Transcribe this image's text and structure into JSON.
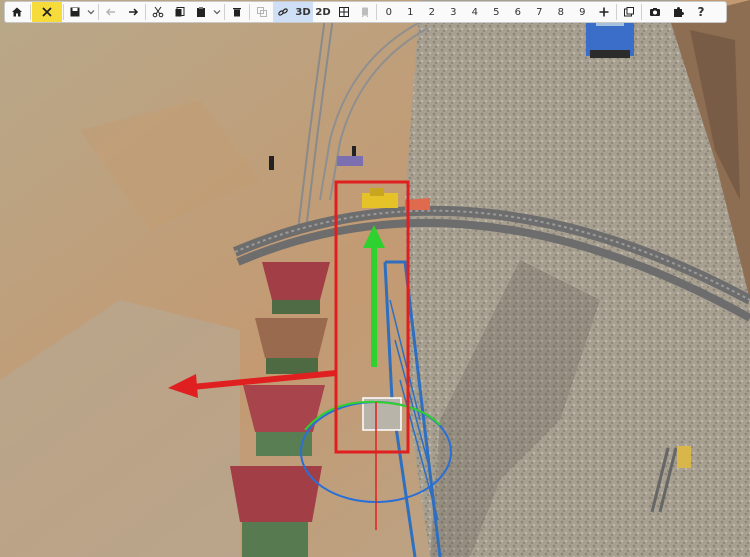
{
  "toolbar": {
    "home": {
      "icon": "home-icon"
    },
    "tools": {
      "icon": "wrench-screwdriver-icon",
      "active": true,
      "color": "#f6dc3a"
    },
    "save": {
      "icon": "save-icon"
    },
    "undo": {
      "icon": "undo-arrow-icon",
      "disabled": true
    },
    "redo": {
      "icon": "redo-arrow-icon"
    },
    "cut": {
      "icon": "scissors-icon"
    },
    "copy": {
      "icon": "copy-icon"
    },
    "paste": {
      "icon": "paste-icon"
    },
    "delete": {
      "icon": "trash-icon"
    },
    "duplicate": {
      "icon": "duplicate-icon",
      "disabled": true
    },
    "link": {
      "icon": "link-icon",
      "active": true,
      "color": "#cfe0f6"
    },
    "view3d_label": "3D",
    "view2d_label": "2D",
    "grid": {
      "icon": "grid-icon"
    },
    "train": {
      "icon": "train-icon",
      "disabled": true
    },
    "layers": [
      "0",
      "1",
      "2",
      "3",
      "4",
      "5",
      "6",
      "7",
      "8",
      "9"
    ],
    "add": {
      "icon": "plus-icon"
    },
    "window": {
      "icon": "window-icon"
    },
    "camera": {
      "icon": "camera-icon"
    },
    "extensions": {
      "icon": "puzzle-icon"
    },
    "help_label": "?"
  },
  "scene": {
    "selection_color": "#e02020",
    "gizmo_y_color": "#2ed12e",
    "gizmo_x_color": "#e02020",
    "gizmo_ring_color": "#2a6fd6",
    "crane_color": "#2f6fbf",
    "hopper_color": "#a04048",
    "terrain_color": "#b9a98c",
    "gravel_color": "#a29a8c"
  }
}
